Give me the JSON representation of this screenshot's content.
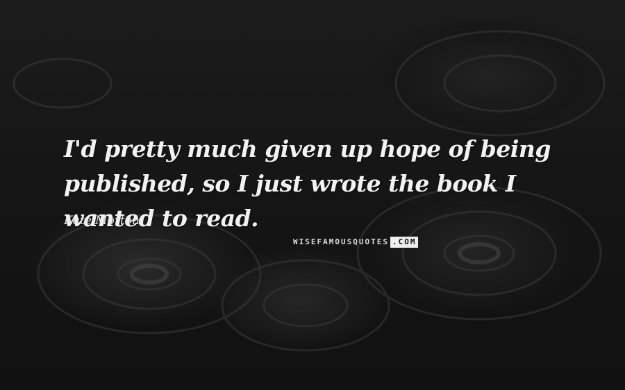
{
  "quote": {
    "text": "I'd pretty much given up hope of being published, so I just wrote the book I wanted to read.",
    "author": "Kate Morton"
  },
  "watermark": {
    "main": "WISEFAMOUSQUOTES",
    "suffix": ".COM"
  },
  "colors": {
    "text": "#f2f2f2",
    "background": "#171717"
  }
}
